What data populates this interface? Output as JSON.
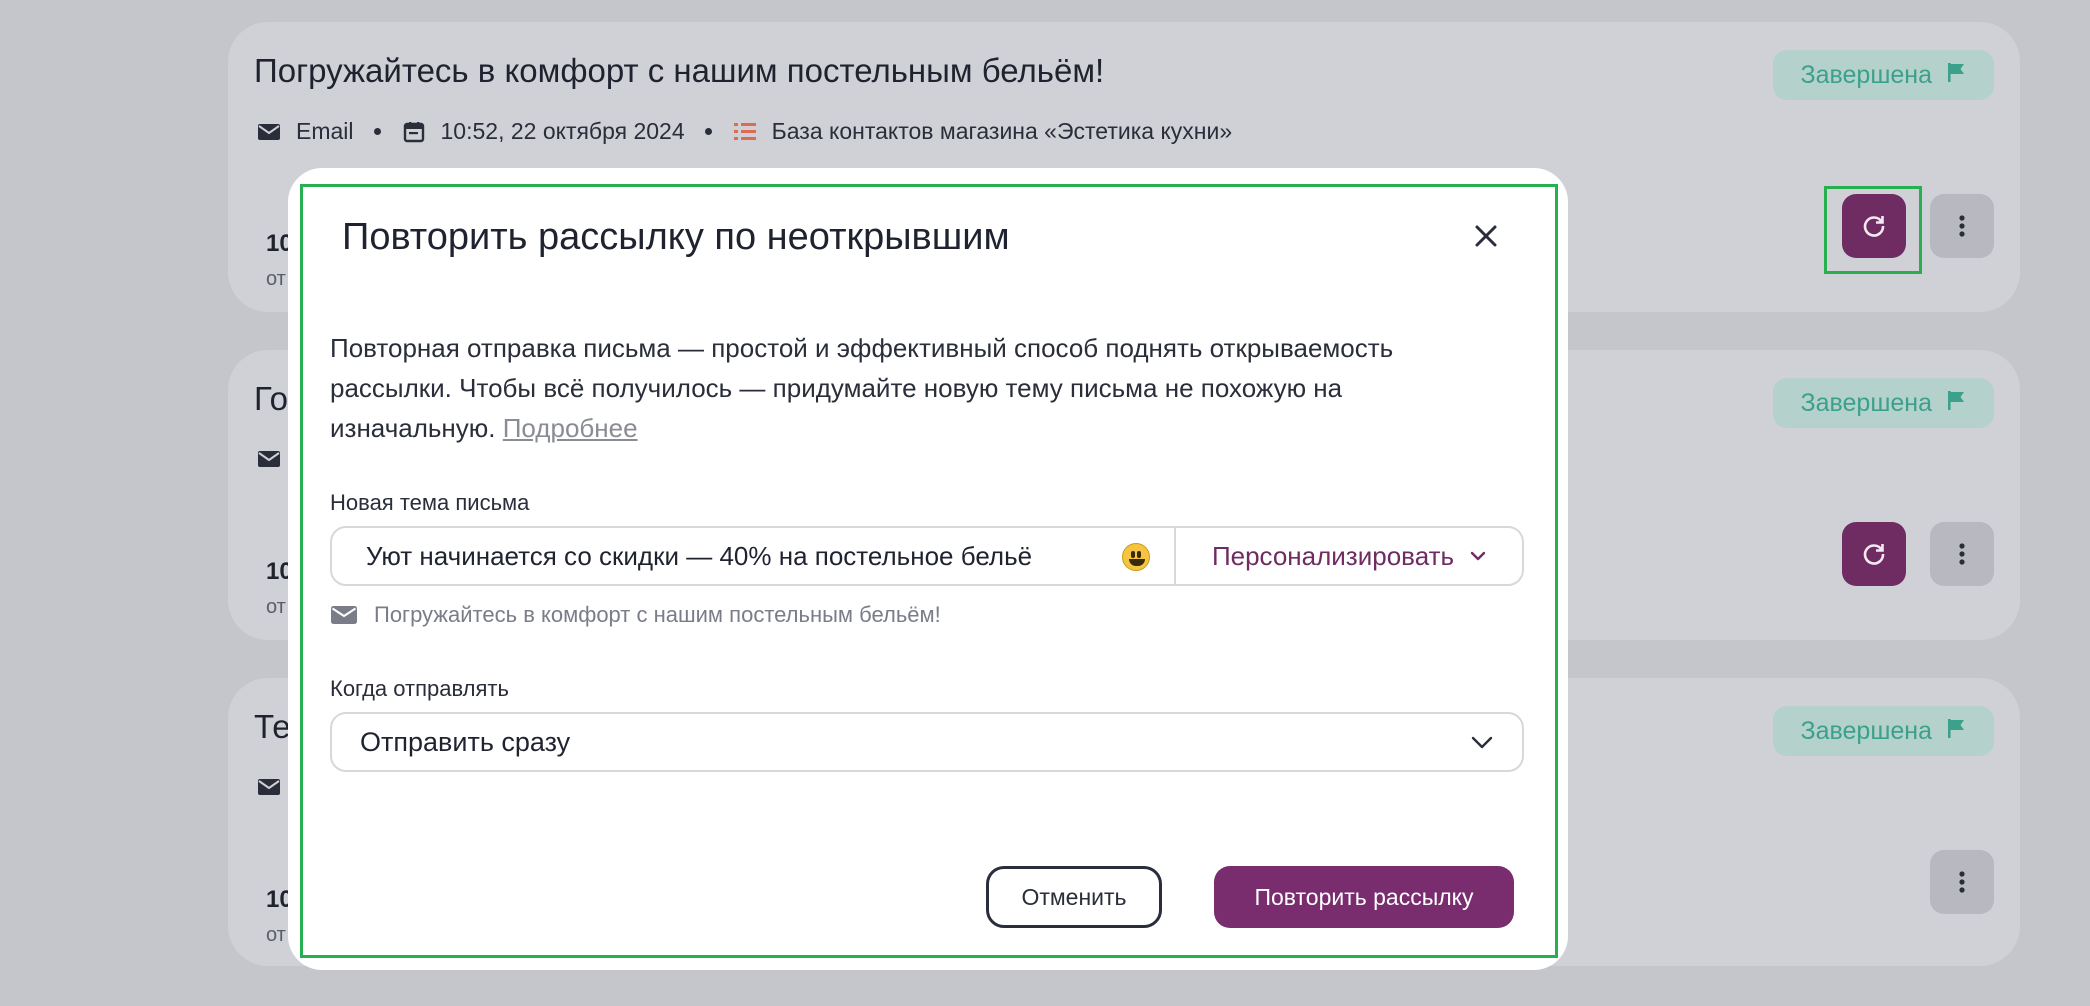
{
  "campaigns": [
    {
      "title": "Погружайтесь в комфорт с нашим постельным бельём!",
      "channel": "Email",
      "datetime": "10:52, 22 октября 2024",
      "contacts": "База контактов магазина «Эстетика кухни»",
      "status": "Завершена",
      "stat": "10",
      "stat_sub": "от"
    },
    {
      "title": "Го",
      "status": "Завершена",
      "stat": "10",
      "stat_sub": "от"
    },
    {
      "title": "Те",
      "status": "Завершена",
      "stat": "10",
      "stat_sub": "от"
    }
  ],
  "modal": {
    "title": "Повторить рассылку по неоткрывшим",
    "description": "Повторная отправка письма — простой и эффективный способ поднять открываемость рассылки. Чтобы всё получилось — придумайте новую тему письма не похожую на изначальную.",
    "more_link": "Подробнее",
    "subject_label": "Новая тема письма",
    "subject_value": "Уют начинается со скидки — 40% на постельное бельё",
    "personalize_label": "Персонализировать",
    "original_subject": "Погружайтесь в комфорт с нашим постельным бельём!",
    "when_label": "Когда отправлять",
    "when_value": "Отправить сразу",
    "cancel_label": "Отменить",
    "submit_label": "Повторить рассылку"
  },
  "colors": {
    "accent": "#7a2d6e",
    "status_text": "#3ba18b",
    "highlight": "#26b050"
  }
}
